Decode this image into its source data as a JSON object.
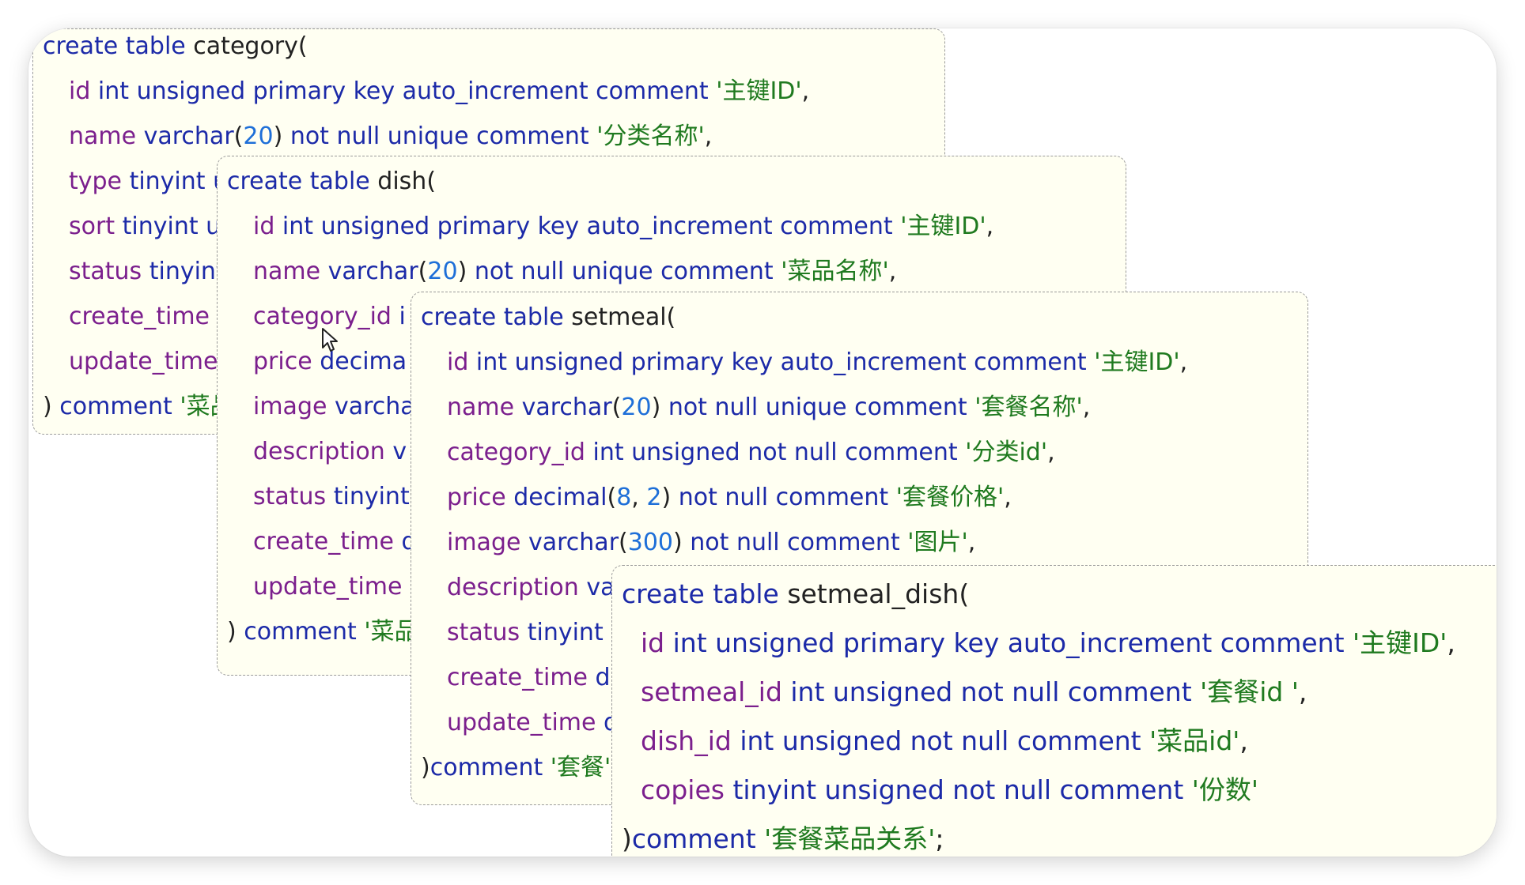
{
  "tables": [
    {
      "name": "category",
      "header": {
        "kw": "create table ",
        "name": "category",
        "paren": "("
      },
      "lines": [
        [
          [
            "fd",
            "id"
          ],
          [
            "kw",
            " int unsigned primary key auto_increment comment "
          ],
          [
            "str",
            "'主键ID'"
          ],
          [
            "pn",
            ","
          ]
        ],
        [
          [
            "fd",
            "name"
          ],
          [
            "kw",
            " varchar"
          ],
          [
            "pn",
            "("
          ],
          [
            "num",
            "20"
          ],
          [
            "pn",
            ")"
          ],
          [
            "kw",
            " not null unique comment "
          ],
          [
            "str",
            "'分类名称'"
          ],
          [
            "pn",
            ","
          ]
        ],
        [
          [
            "fd",
            "type"
          ],
          [
            "kw",
            " tinyint u"
          ]
        ],
        [
          [
            "fd",
            "sort"
          ],
          [
            "kw",
            " tinyint u"
          ]
        ],
        [
          [
            "fd",
            "status"
          ],
          [
            "kw",
            " tinyint"
          ]
        ],
        [
          [
            "fd",
            "create_time"
          ]
        ],
        [
          [
            "fd",
            "update_time"
          ]
        ]
      ],
      "footer": [
        [
          "pn",
          ") "
        ],
        [
          "kw",
          "comment "
        ],
        [
          "str",
          "'菜品"
        ]
      ]
    },
    {
      "name": "dish",
      "header": {
        "kw": "create table ",
        "name": "dish",
        "paren": "("
      },
      "lines": [
        [
          [
            "fd",
            "id"
          ],
          [
            "kw",
            " int unsigned primary key auto_increment comment "
          ],
          [
            "str",
            "'主键ID'"
          ],
          [
            "pn",
            ","
          ]
        ],
        [
          [
            "fd",
            "name"
          ],
          [
            "kw",
            " varchar"
          ],
          [
            "pn",
            "("
          ],
          [
            "num",
            "20"
          ],
          [
            "pn",
            ")"
          ],
          [
            "kw",
            " not null unique comment "
          ],
          [
            "str",
            "'菜品名称'"
          ],
          [
            "pn",
            ","
          ]
        ],
        [
          [
            "fd",
            "category_id"
          ],
          [
            "kw",
            " i"
          ]
        ],
        [
          [
            "fd",
            "price"
          ],
          [
            "kw",
            " decima"
          ]
        ],
        [
          [
            "fd",
            "image"
          ],
          [
            "kw",
            " varcha"
          ]
        ],
        [
          [
            "fd",
            "description"
          ],
          [
            "kw",
            " v"
          ]
        ],
        [
          [
            "fd",
            "status"
          ],
          [
            "kw",
            " tinyint"
          ]
        ],
        [
          [
            "fd",
            "create_time"
          ],
          [
            "kw",
            " d"
          ]
        ],
        [
          [
            "fd",
            "update_time"
          ]
        ]
      ],
      "footer": [
        [
          "pn",
          ") "
        ],
        [
          "kw",
          "comment "
        ],
        [
          "str",
          "'菜品"
        ]
      ]
    },
    {
      "name": "setmeal",
      "header": {
        "kw": "create table ",
        "name": "setmeal",
        "paren": "("
      },
      "lines": [
        [
          [
            "fd",
            "id"
          ],
          [
            "kw",
            " int unsigned primary key auto_increment comment "
          ],
          [
            "str",
            "'主键ID'"
          ],
          [
            "pn",
            ","
          ]
        ],
        [
          [
            "fd",
            "name"
          ],
          [
            "kw",
            " varchar"
          ],
          [
            "pn",
            "("
          ],
          [
            "num",
            "20"
          ],
          [
            "pn",
            ")"
          ],
          [
            "kw",
            " not null unique comment "
          ],
          [
            "str",
            "'套餐名称'"
          ],
          [
            "pn",
            ","
          ]
        ],
        [
          [
            "fd",
            "category_id"
          ],
          [
            "kw",
            " int unsigned not null comment "
          ],
          [
            "str",
            "'分类id'"
          ],
          [
            "pn",
            ","
          ]
        ],
        [
          [
            "fd",
            "price"
          ],
          [
            "kw",
            " decimal"
          ],
          [
            "pn",
            "("
          ],
          [
            "num",
            "8"
          ],
          [
            "pn",
            ", "
          ],
          [
            "num",
            "2"
          ],
          [
            "pn",
            ")"
          ],
          [
            "kw",
            " not null comment "
          ],
          [
            "str",
            "'套餐价格'"
          ],
          [
            "pn",
            ","
          ]
        ],
        [
          [
            "fd",
            "image"
          ],
          [
            "kw",
            " varchar"
          ],
          [
            "pn",
            "("
          ],
          [
            "num",
            "300"
          ],
          [
            "pn",
            ")"
          ],
          [
            "kw",
            " not null comment "
          ],
          [
            "str",
            "'图片'"
          ],
          [
            "pn",
            ","
          ]
        ],
        [
          [
            "fd",
            "description"
          ],
          [
            "kw",
            " va"
          ]
        ],
        [
          [
            "fd",
            "status"
          ],
          [
            "kw",
            " tinyint u"
          ]
        ],
        [
          [
            "fd",
            "create_time"
          ],
          [
            "kw",
            " d"
          ]
        ],
        [
          [
            "fd",
            "update_time"
          ],
          [
            "kw",
            " d"
          ]
        ]
      ],
      "footer": [
        [
          "pn",
          ")"
        ],
        [
          "kw",
          "comment "
        ],
        [
          "str",
          "'套餐'"
        ]
      ]
    },
    {
      "name": "setmeal_dish",
      "header": {
        "kw": "create table ",
        "name": "setmeal_dish",
        "paren": "("
      },
      "lines": [
        [
          [
            "fd",
            "id"
          ],
          [
            "kw",
            " int unsigned primary key auto_increment comment "
          ],
          [
            "str",
            "'主键ID'"
          ],
          [
            "pn",
            ","
          ]
        ],
        [
          [
            "fd",
            "setmeal_id"
          ],
          [
            "kw",
            " int unsigned not null comment "
          ],
          [
            "str",
            "'套餐id '"
          ],
          [
            "pn",
            ","
          ]
        ],
        [
          [
            "fd",
            "dish_id"
          ],
          [
            "kw",
            " int unsigned not null comment "
          ],
          [
            "str",
            "'菜品id'"
          ],
          [
            "pn",
            ","
          ]
        ],
        [
          [
            "fd",
            "copies"
          ],
          [
            "kw",
            " tinyint unsigned not null comment "
          ],
          [
            "str",
            "'份数'"
          ]
        ]
      ],
      "footer": [
        [
          "pn",
          ")"
        ],
        [
          "kw",
          "comment "
        ],
        [
          "str",
          "'套餐菜品关系'"
        ],
        [
          "pn",
          ";"
        ]
      ]
    }
  ]
}
